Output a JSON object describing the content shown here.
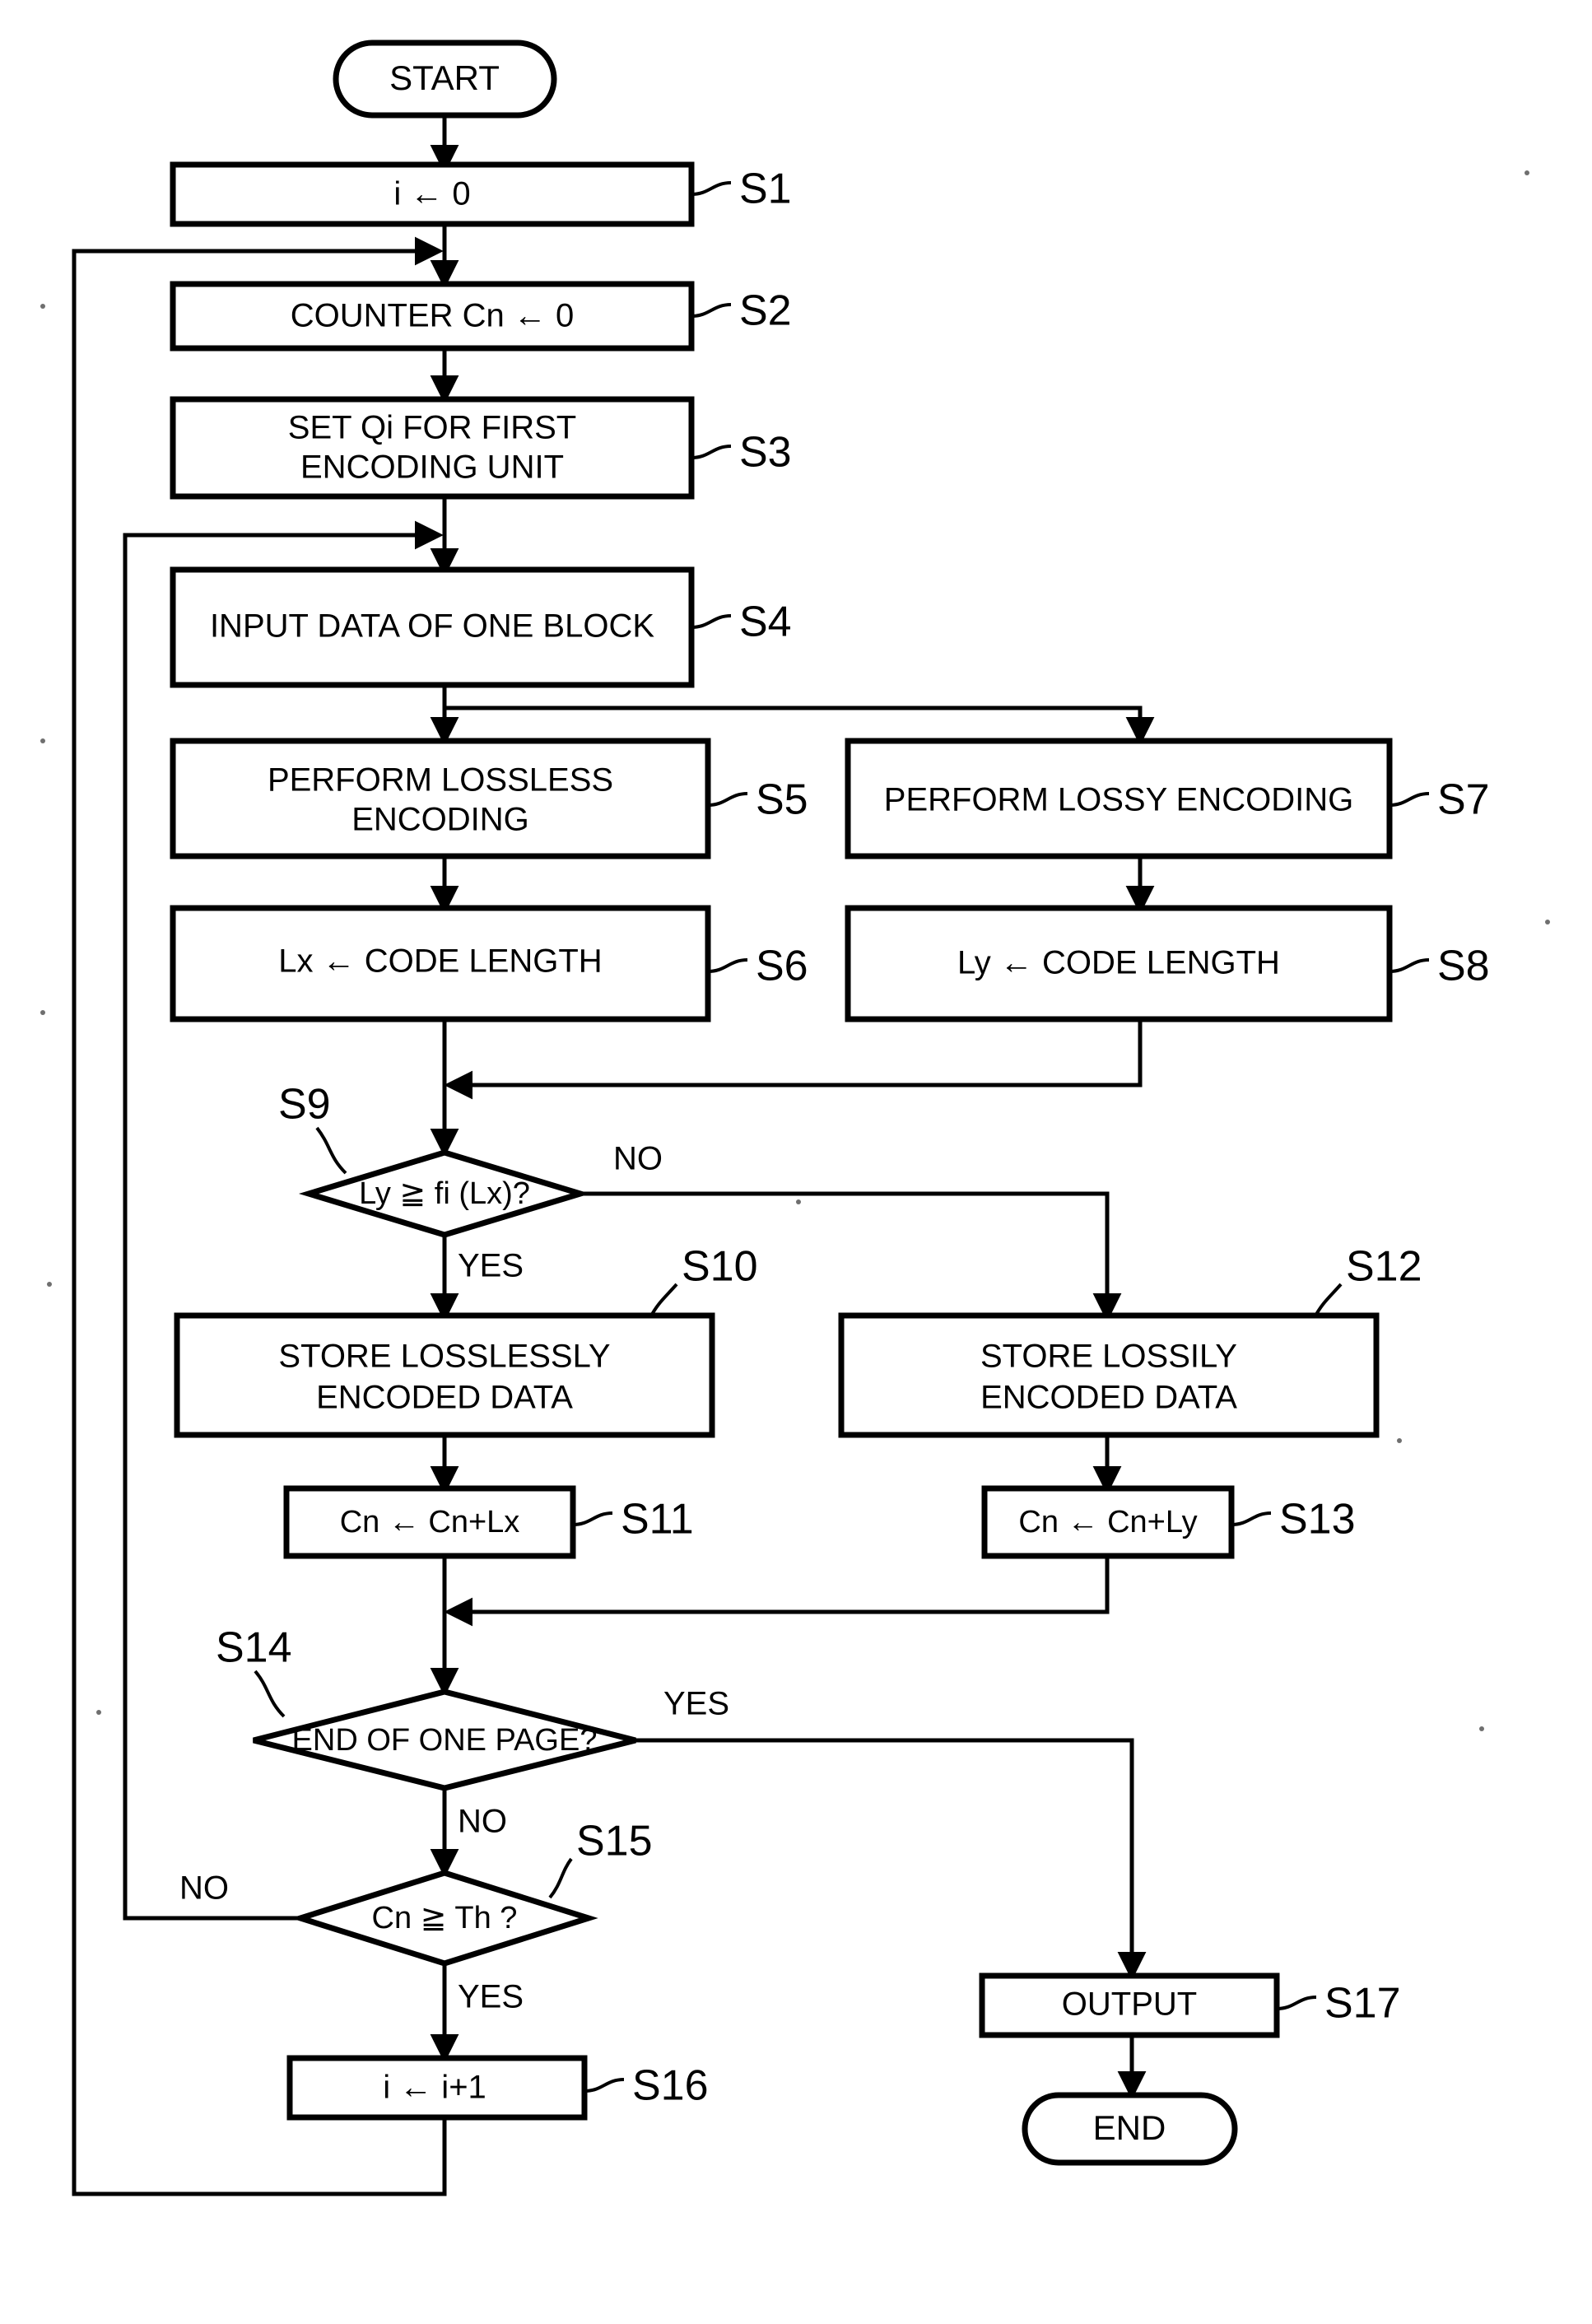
{
  "figure": {
    "type": "flowchart",
    "orientation": "top-to-bottom",
    "background": "#ffffff",
    "line_color": "#000000"
  },
  "nodes": {
    "start": {
      "id": "START",
      "shape": "terminator",
      "label": "START"
    },
    "s1": {
      "id": "S1",
      "shape": "process",
      "label": "i ← 0"
    },
    "s2": {
      "id": "S2",
      "shape": "process",
      "label": "COUNTER Cn ← 0"
    },
    "s3": {
      "id": "S3",
      "shape": "process",
      "label_line1": "SET Qi FOR FIRST",
      "label_line2": "ENCODING UNIT"
    },
    "s4": {
      "id": "S4",
      "shape": "process",
      "label": "INPUT DATA OF ONE BLOCK"
    },
    "s5": {
      "id": "S5",
      "shape": "process",
      "label_line1": "PERFORM LOSSLESS",
      "label_line2": "ENCODING"
    },
    "s6": {
      "id": "S6",
      "shape": "process",
      "label": "Lx ← CODE LENGTH"
    },
    "s7": {
      "id": "S7",
      "shape": "process",
      "label": "PERFORM LOSSY ENCODING"
    },
    "s8": {
      "id": "S8",
      "shape": "process",
      "label": "Ly ← CODE LENGTH"
    },
    "s9": {
      "id": "S9",
      "shape": "decision",
      "label": "Ly ≧ fi (Lx)?"
    },
    "s10": {
      "id": "S10",
      "shape": "process",
      "label_line1": "STORE LOSSLESSLY",
      "label_line2": "ENCODED DATA"
    },
    "s11": {
      "id": "S11",
      "shape": "process",
      "label": "Cn ← Cn+Lx"
    },
    "s12": {
      "id": "S12",
      "shape": "process",
      "label_line1": "STORE LOSSILY",
      "label_line2": "ENCODED DATA"
    },
    "s13": {
      "id": "S13",
      "shape": "process",
      "label": "Cn ← Cn+Ly"
    },
    "s14": {
      "id": "S14",
      "shape": "decision",
      "label": "END OF ONE PAGE?"
    },
    "s15": {
      "id": "S15",
      "shape": "decision",
      "label": "Cn ≧ Th ?"
    },
    "s16": {
      "id": "S16",
      "shape": "process",
      "label": "i ← i+1"
    },
    "s17": {
      "id": "S17",
      "shape": "process",
      "label": "OUTPUT"
    },
    "end": {
      "id": "END",
      "shape": "terminator",
      "label": "END"
    }
  },
  "branch_labels": {
    "s9_no": "NO",
    "s9_yes": "YES",
    "s14_yes": "YES",
    "s14_no": "NO",
    "s15_no": "NO",
    "s15_yes": "YES"
  },
  "step_tags": {
    "s1": "S1",
    "s2": "S2",
    "s3": "S3",
    "s4": "S4",
    "s5": "S5",
    "s6": "S6",
    "s7": "S7",
    "s8": "S8",
    "s9": "S9",
    "s10": "S10",
    "s11": "S11",
    "s12": "S12",
    "s13": "S13",
    "s14": "S14",
    "s15": "S15",
    "s16": "S16",
    "s17": "S17"
  }
}
